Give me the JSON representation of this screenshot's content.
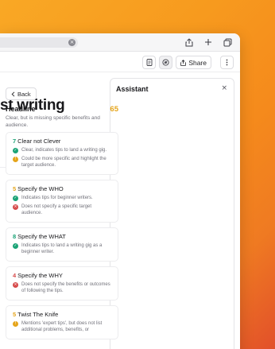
{
  "browser": {
    "url_clear_glyph": "×",
    "icons": [
      "share-icon",
      "plus-icon",
      "tabs-icon"
    ]
  },
  "toolbar": {
    "share_label": "Share",
    "icons": [
      "document-icon",
      "assistant-icon",
      "more-icon"
    ]
  },
  "document": {
    "title_fragment": "st writing"
  },
  "assistant": {
    "title": "Assistant",
    "close_glyph": "×",
    "back_label": "Back",
    "headline": {
      "label": "Headline",
      "score": "65",
      "description": "Clear, but is missing specific benefits and audience."
    },
    "cards": [
      {
        "num": "7",
        "num_color": "green",
        "title": "Clear not Clever",
        "points": [
          {
            "status": "green",
            "text": "Clear, indicates tips to land a writing gig."
          },
          {
            "status": "amber",
            "text": "Could be more specific and highlight the target audience."
          }
        ]
      },
      {
        "num": "5",
        "num_color": "amber",
        "title": "Specify the WHO",
        "points": [
          {
            "status": "green",
            "text": "Indicates tips for beginner writers."
          },
          {
            "status": "red",
            "text": "Does not specify a specific target audience."
          }
        ]
      },
      {
        "num": "8",
        "num_color": "green",
        "title": "Specify the WHAT",
        "points": [
          {
            "status": "green",
            "text": "Indicates tips to land a writing gig as a beginner writer."
          }
        ]
      },
      {
        "num": "4",
        "num_color": "red",
        "title": "Specify the WHY",
        "points": [
          {
            "status": "red",
            "text": "Does not specify the benefits or outcomes of following the tips."
          }
        ]
      },
      {
        "num": "5",
        "num_color": "amber",
        "title": "Twist The Knife",
        "points": [
          {
            "status": "amber",
            "text": "Mentions 'expert tips', but does not list additional problems, benefits, or"
          }
        ]
      }
    ]
  },
  "colors": {
    "green": "#1aa376",
    "amber": "#e5a51b",
    "red": "#d64a4a"
  }
}
